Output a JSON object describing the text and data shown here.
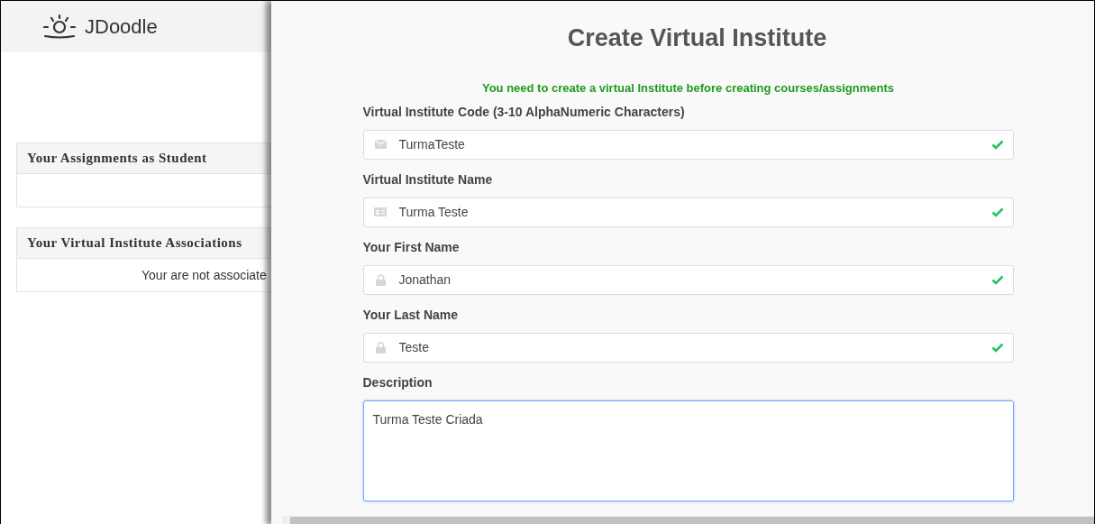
{
  "logo": {
    "text": "JDoodle"
  },
  "panels": [
    {
      "title": "Your Assignments as Student"
    },
    {
      "title": "Your Virtual Institute Associations",
      "body": "Your are not associate"
    }
  ],
  "modal": {
    "title": "Create Virtual Institute",
    "notice": "You need to create a virtual Institute before creating courses/assignments",
    "fields": [
      {
        "label": "Virtual Institute Code (3-10 AlphaNumeric Characters)",
        "kind": "envelope",
        "value": "TurmaTeste",
        "valid": true
      },
      {
        "label": "Virtual Institute Name",
        "kind": "card",
        "value": "Turma Teste",
        "valid": true
      },
      {
        "label": "Your First Name",
        "kind": "lock",
        "value": "Jonathan",
        "valid": true
      },
      {
        "label": "Your Last Name",
        "kind": "lock",
        "value": "Teste",
        "valid": true
      }
    ],
    "description": {
      "label": "Description",
      "value": "Turma Teste Criada",
      "focused": true
    }
  }
}
